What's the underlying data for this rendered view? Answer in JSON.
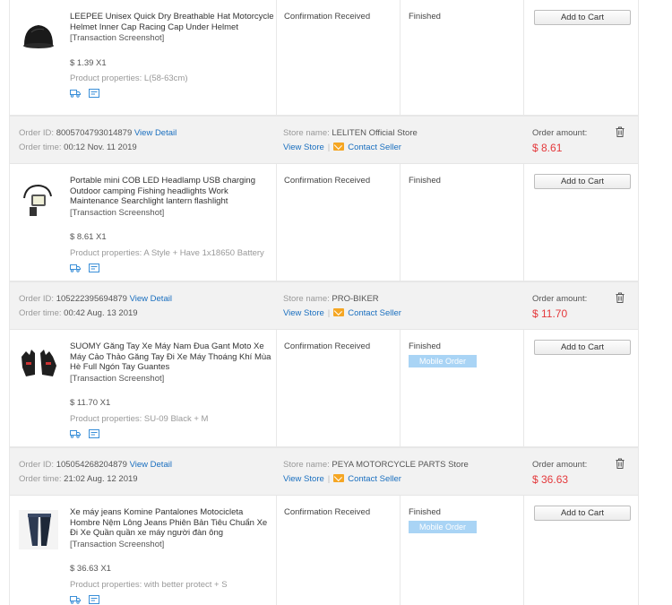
{
  "labels": {
    "order_id": "Order ID:",
    "order_time": "Order time:",
    "view_detail": "View Detail",
    "store_name": "Store name:",
    "view_store": "View Store",
    "separator": "|",
    "contact_seller": "Contact Seller",
    "order_amount": "Order amount:",
    "add_to_cart": "Add to Cart",
    "snapshot": "[Transaction Screenshot]",
    "properties": "Product properties:",
    "mobile_order": "Mobile Order"
  },
  "top_item": {
    "title": "LEEPEE Unisex Quick Dry Breathable Hat Motorcycle Helmet Inner Cap Racing Cap Under Helmet",
    "price": "$ 1.39 X1",
    "properties": "L(58-63cm)",
    "status": "Confirmation Received",
    "finish": "Finished",
    "mobile": false
  },
  "orders": [
    {
      "id": "8005704793014879",
      "time": "00:12 Nov. 11 2019",
      "store": "LELITEN Official Store",
      "amount": "$ 8.61",
      "item": {
        "title": "Portable mini COB LED Headlamp USB charging Outdoor camping Fishing headlights Work Maintenance Searchlight lantern flashlight",
        "price": "$ 8.61 X1",
        "properties": "A Style + Have 1x18650 Battery",
        "status": "Confirmation Received",
        "finish": "Finished",
        "mobile": false
      }
    },
    {
      "id": "105222395694879",
      "time": "00:42 Aug. 13 2019",
      "store": "PRO-BIKER",
      "amount": "$ 11.70",
      "item": {
        "title": "SUOMY Găng Tay Xe Máy Nam Đua Gant Moto Xe Máy Cảo Thảo Găng Tay Đi Xe Máy Thoáng Khí Mùa Hè Full Ngón Tay Guantes",
        "price": "$ 11.70 X1",
        "properties": "SU-09 Black + M",
        "status": "Confirmation Received",
        "finish": "Finished",
        "mobile": true
      }
    },
    {
      "id": "105054268204879",
      "time": "21:02 Aug. 12 2019",
      "store": "PEYA MOTORCYCLE PARTS Store",
      "amount": "$ 36.63",
      "item": {
        "title": "Xe máy jeans Komine Pantalones Motocicleta Hombre Nệm Lông Jeans Phiên Bản Tiêu Chuẩn Xe Đi Xe Quần quần xe máy người đàn ông",
        "price": "$ 36.63 X1",
        "properties": "with better protect + S",
        "status": "Confirmation Received",
        "finish": "Finished",
        "mobile": true
      }
    }
  ],
  "colors": {
    "link": "#1a6fbf",
    "amount": "#e4393c",
    "header_bg": "#f2f2f2",
    "badge": "#a9d4f5"
  }
}
